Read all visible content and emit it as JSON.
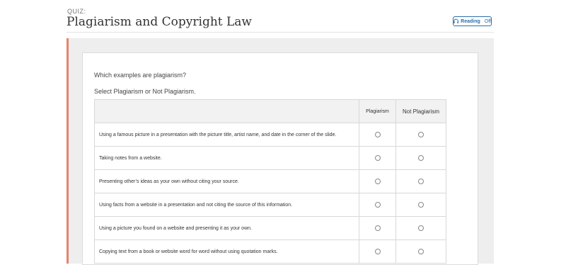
{
  "header": {
    "quiz_label": "QUIZ:",
    "title": "Plagiarism and Copyright Law",
    "reading_label": "Reading",
    "reading_state": "Off"
  },
  "question": {
    "prompt": "Which examples are plagiarism?",
    "instruction": "Select Plagiarism or Not Plagiarism."
  },
  "table": {
    "columns": [
      "Plagiarism",
      "Not Plagiarism"
    ],
    "rows": [
      "Using a famous picture in a presentation with the picture title, artist name, and date in the corner of the slide.",
      "Taking notes from a website.",
      "Presenting other’s ideas as your own without citing your source.",
      "Using facts from a website in a presentation and not citing the source of this information.",
      "Using a picture you found on a website and presenting it as your own.",
      "Copying text from a book or website word for word without using quotation marks."
    ]
  },
  "colors": {
    "accent": "#e8826a",
    "link": "#2d6ea8"
  },
  "icons": {
    "reading": "headphones-icon"
  }
}
